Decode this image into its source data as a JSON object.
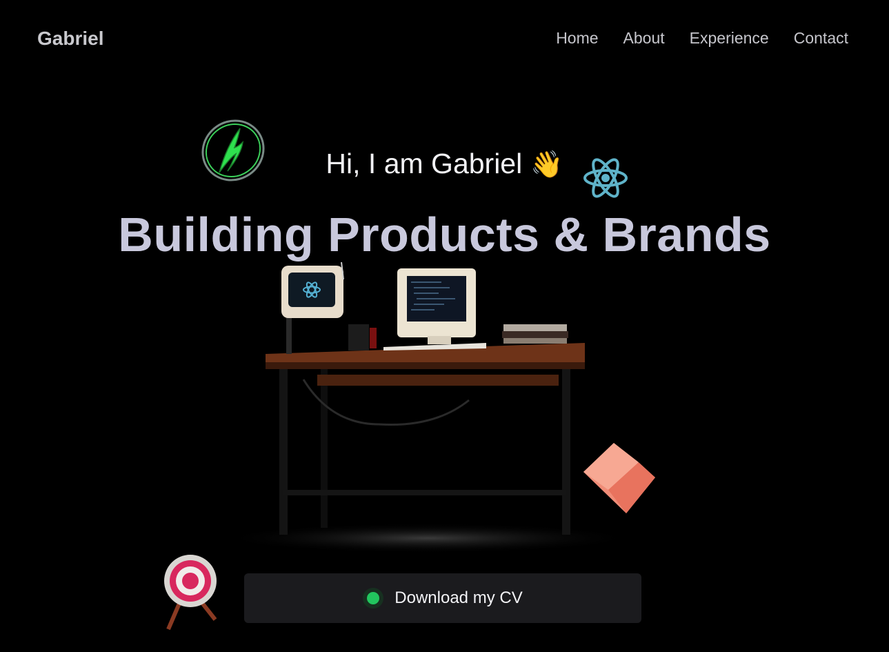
{
  "nav": {
    "logo": "Gabriel",
    "links": [
      {
        "label": "Home"
      },
      {
        "label": "About"
      },
      {
        "label": "Experience"
      },
      {
        "label": "Contact"
      }
    ]
  },
  "hero": {
    "greeting": "Hi, I am Gabriel",
    "wave_emoji": "👋",
    "headline": "Building Products & Brands"
  },
  "cta": {
    "label": "Download my CV",
    "status_color": "#22c55e"
  },
  "icons": [
    "ring-logo-icon",
    "react-icon",
    "desk-scene-illustration",
    "cube-icon",
    "target-icon"
  ]
}
